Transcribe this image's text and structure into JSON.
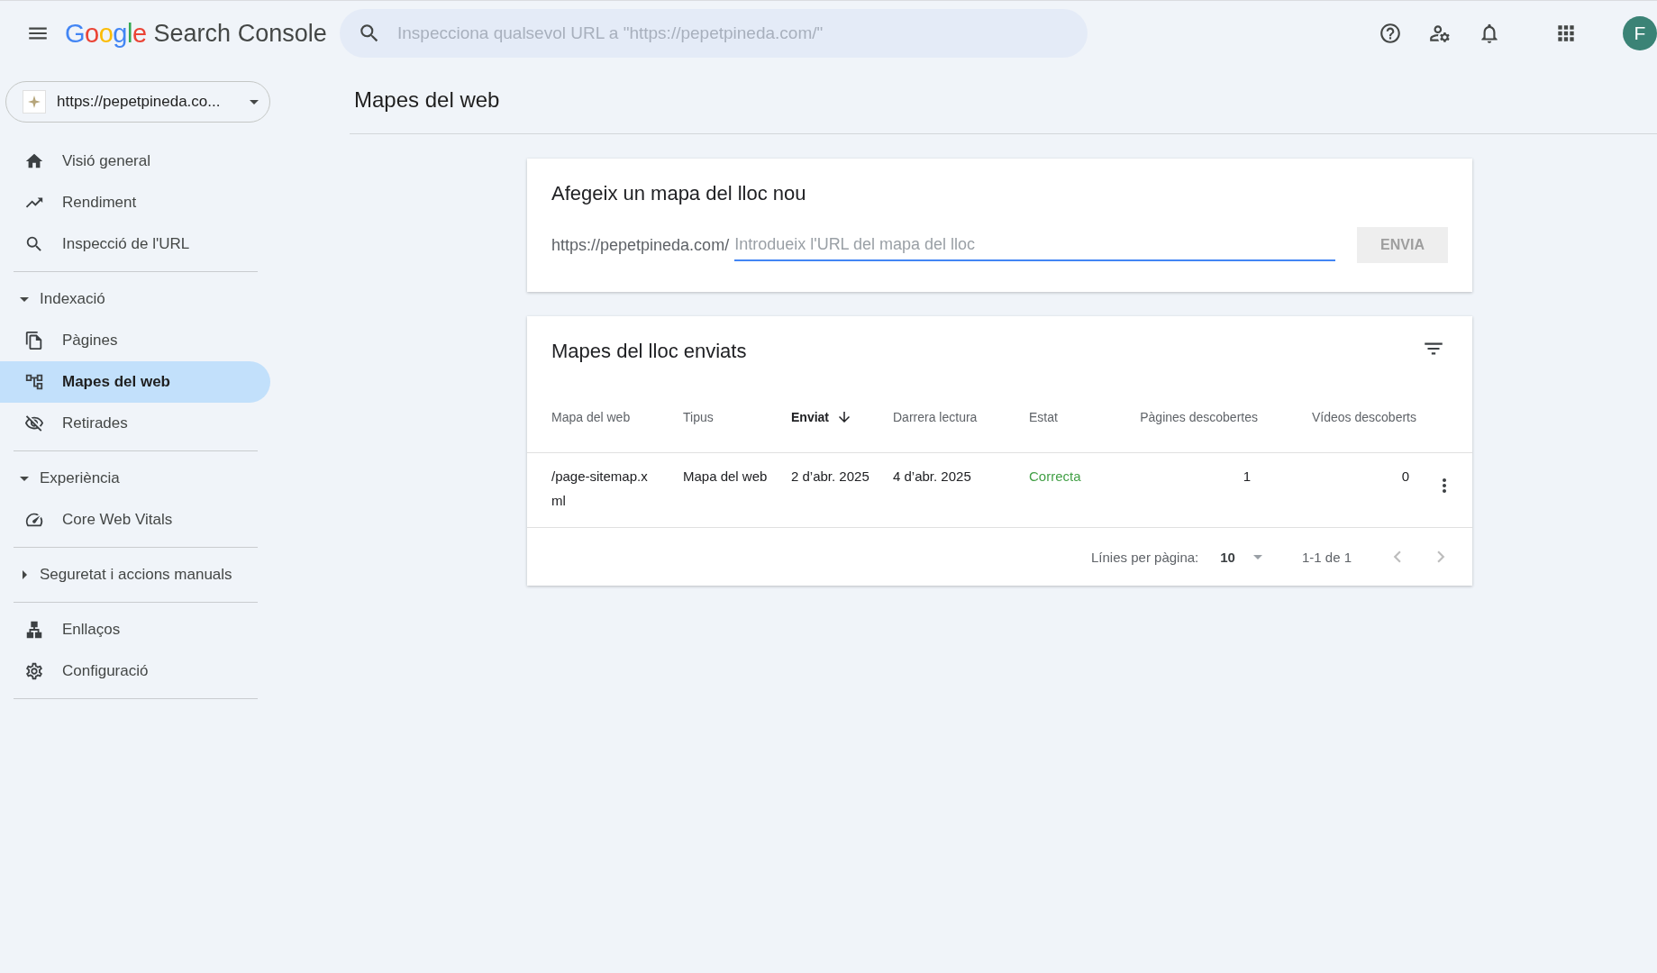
{
  "header": {
    "brand": "Google",
    "product": "Search Console",
    "search_placeholder": "Inspecciona qualsevol URL a \"https://pepetpineda.com/\"",
    "avatar": "F"
  },
  "property": {
    "label": "https://pepetpineda.co..."
  },
  "sidebar": {
    "groups": [
      {
        "items": [
          {
            "label": "Visió general",
            "selected": false
          },
          {
            "label": "Rendiment",
            "selected": false
          },
          {
            "label": "Inspecció de l'URL",
            "selected": false
          }
        ]
      },
      {
        "heading": {
          "label": "Indexació",
          "expanded": true
        },
        "items": [
          {
            "label": "Pàgines",
            "selected": false
          },
          {
            "label": "Mapes del web",
            "selected": true
          },
          {
            "label": "Retirades",
            "selected": false
          }
        ]
      },
      {
        "heading": {
          "label": "Experiència",
          "expanded": true
        },
        "items": [
          {
            "label": "Core Web Vitals",
            "selected": false
          }
        ]
      },
      {
        "heading": {
          "label": "Seguretat i accions manuals",
          "expanded": false
        }
      },
      {
        "items": [
          {
            "label": "Enllaços",
            "selected": false
          },
          {
            "label": "Configuració",
            "selected": false
          }
        ]
      }
    ]
  },
  "page_title": "Mapes del web",
  "add_card": {
    "title": "Afegeix un mapa del lloc nou",
    "prefix": "https://pepetpineda.com/",
    "placeholder": "Introdueix l'URL del mapa del lloc",
    "button": {
      "label": "ENVIA",
      "disabled": true
    }
  },
  "table_card": {
    "title": "Mapes del lloc enviats",
    "columns": [
      {
        "label": "Mapa del web",
        "sorted": false
      },
      {
        "label": "Tipus",
        "sorted": false
      },
      {
        "label": "Enviat",
        "sorted": true
      },
      {
        "label": "Darrera lectura",
        "sorted": false
      },
      {
        "label": "Estat",
        "sorted": false
      },
      {
        "label": "Pàgines descobertes",
        "sorted": false
      },
      {
        "label": "Vídeos descoberts",
        "sorted": false
      }
    ],
    "rows": [
      {
        "cells": [
          "/page-sitemap.xml",
          "Mapa del web",
          "2 d’abr. 2025",
          "4 d’abr. 2025",
          "Correcta",
          "1",
          "0"
        ]
      }
    ],
    "pagination": {
      "rows_label": "Línies per pàgina:",
      "rows_value": "10",
      "range": "1-1 de 1"
    }
  }
}
